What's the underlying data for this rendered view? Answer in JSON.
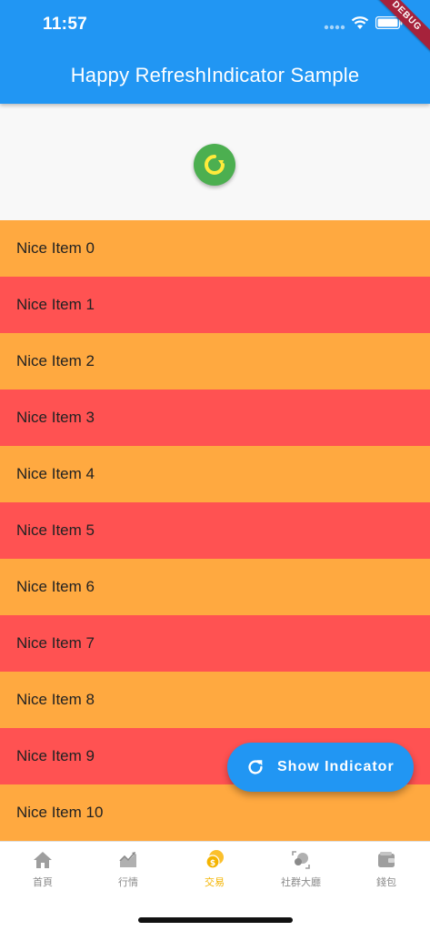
{
  "status_bar": {
    "time": "11:57"
  },
  "app_bar": {
    "title": "Happy RefreshIndicator Sample",
    "debug_banner": "DEBUG"
  },
  "list": {
    "items": [
      "Nice Item 0",
      "Nice Item 1",
      "Nice Item 2",
      "Nice Item 3",
      "Nice Item 4",
      "Nice Item 5",
      "Nice Item 6",
      "Nice Item 7",
      "Nice Item 8",
      "Nice Item 9",
      "Nice Item 10"
    ]
  },
  "fab": {
    "label": "Show Indicator",
    "icon": "refresh-icon"
  },
  "bottom_nav": {
    "items": [
      {
        "label": "首頁",
        "icon": "home-icon"
      },
      {
        "label": "行情",
        "icon": "chart-icon"
      },
      {
        "label": "交易",
        "icon": "coins-icon",
        "active": true
      },
      {
        "label": "社群大廳",
        "icon": "community-icon"
      },
      {
        "label": "錢包",
        "icon": "wallet-icon"
      }
    ]
  },
  "colors": {
    "primary": "#2196f3",
    "orange_row": "#ffa940",
    "red_row": "#ff5252",
    "refresh_green": "#4caf50",
    "refresh_yellow": "#ffeb3b",
    "active_nav": "#f4b400"
  }
}
